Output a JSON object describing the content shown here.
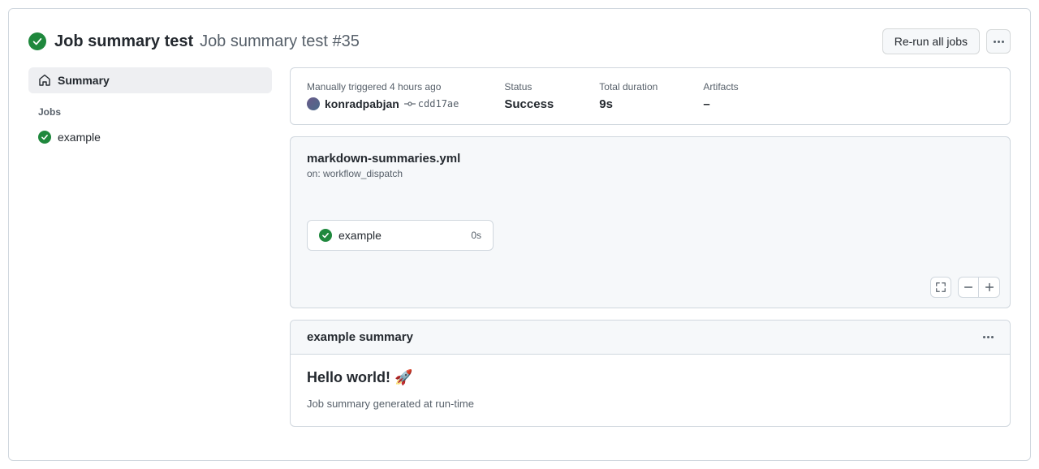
{
  "header": {
    "title": "Job summary test",
    "run_label": "Job summary test #35",
    "rerun_button": "Re-run all jobs"
  },
  "sidebar": {
    "summary_label": "Summary",
    "jobs_heading": "Jobs",
    "items": [
      {
        "label": "example"
      }
    ]
  },
  "meta": {
    "triggered_label": "Manually triggered 4 hours ago",
    "user": "konradpabjan",
    "commit": "cdd17ae",
    "status_label": "Status",
    "status_value": "Success",
    "duration_label": "Total duration",
    "duration_value": "9s",
    "artifacts_label": "Artifacts",
    "artifacts_value": "–"
  },
  "workflow": {
    "file": "markdown-summaries.yml",
    "on_label": "on: workflow_dispatch",
    "job": {
      "name": "example",
      "duration": "0s"
    }
  },
  "summary": {
    "title": "example summary",
    "heading": "Hello world! 🚀",
    "body": "Job summary generated at run-time"
  }
}
